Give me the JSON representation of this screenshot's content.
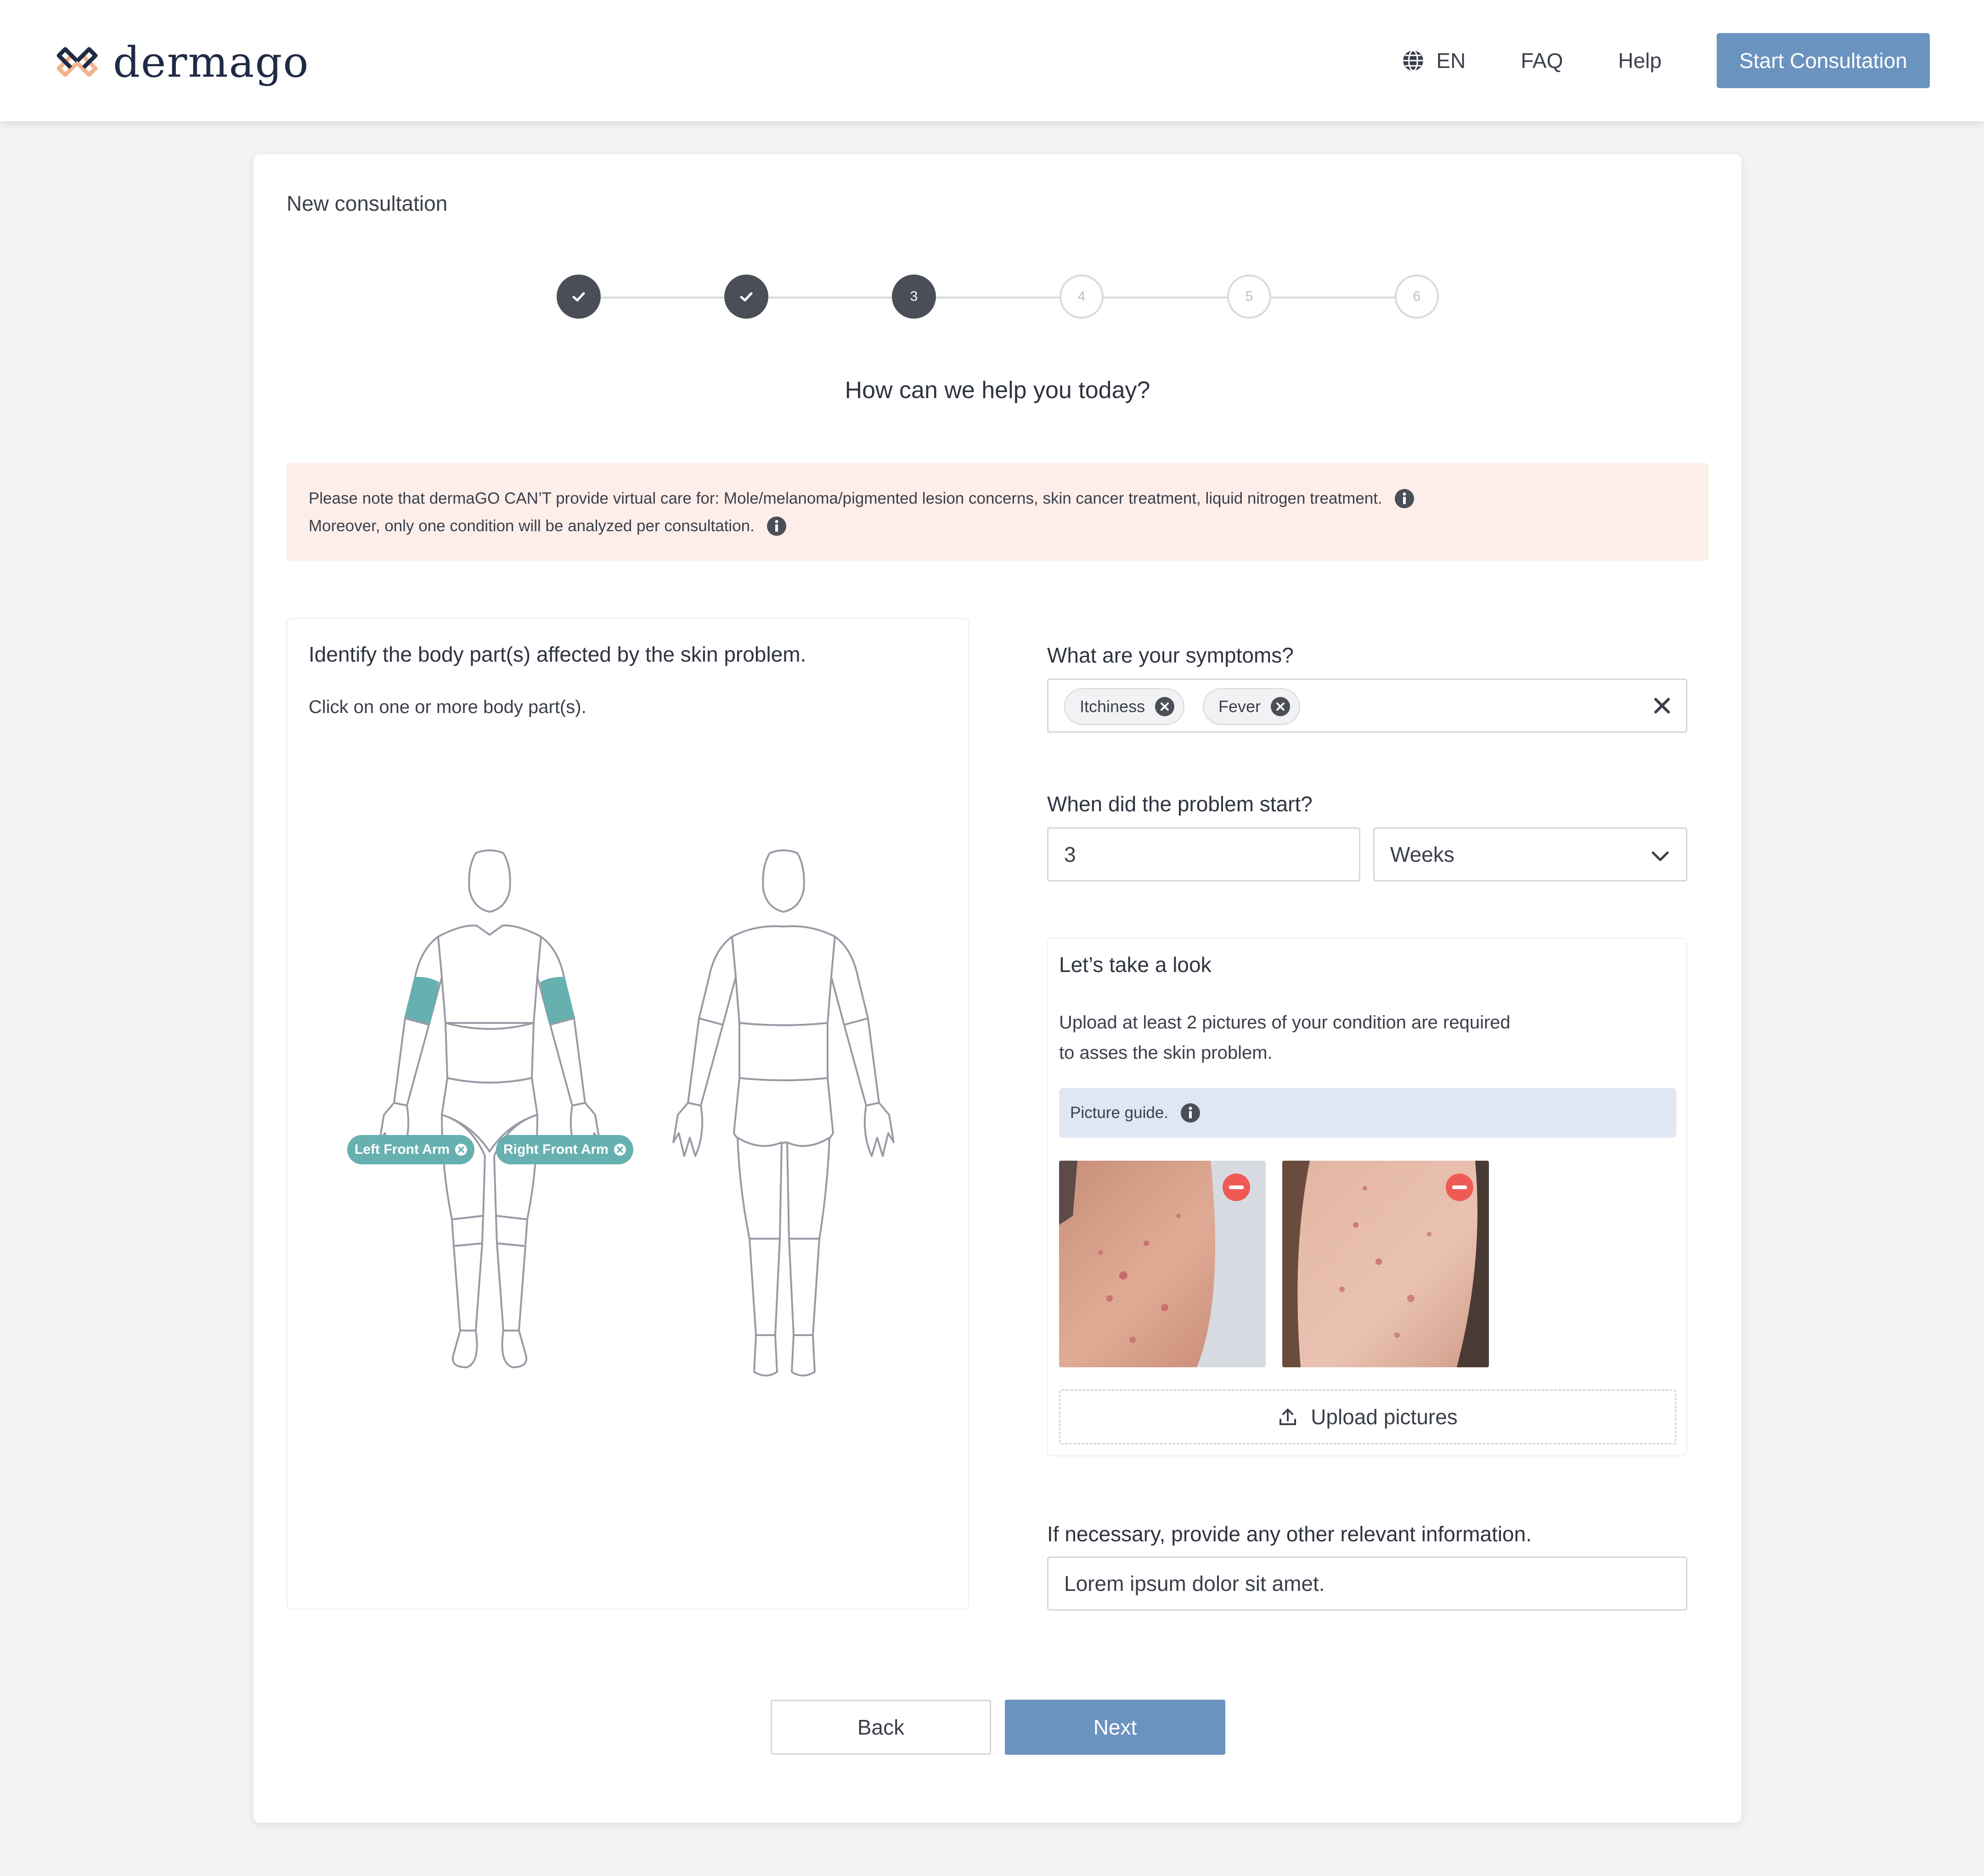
{
  "header": {
    "logo_text": "dermago",
    "language": "EN",
    "nav_faq": "FAQ",
    "nav_help": "Help",
    "start_button": "Start Consultation"
  },
  "consultation": {
    "title": "New consultation",
    "steps": [
      {
        "label": "",
        "state": "done"
      },
      {
        "label": "",
        "state": "done"
      },
      {
        "label": "3",
        "state": "current"
      },
      {
        "label": "4",
        "state": "todo"
      },
      {
        "label": "5",
        "state": "todo"
      },
      {
        "label": "6",
        "state": "todo"
      }
    ],
    "question": "How can we help you today?",
    "notice_line1": "Please note that dermaGO CAN’T provide virtual care for: Mole/melanoma/pigmented lesion concerns, skin cancer treatment, liquid nitrogen treatment.",
    "notice_line2": "Moreover, only one condition will be analyzed per consultation."
  },
  "body_map": {
    "title": "Identify the body part(s) affected by the skin problem.",
    "subtitle": "Click on one or more body part(s).",
    "selected": [
      "Left Front Arm",
      "Right Front Arm"
    ]
  },
  "symptoms": {
    "label": "What are your symptoms?",
    "tags": [
      "Itchiness",
      "Fever"
    ]
  },
  "onset": {
    "label": "When did the problem start?",
    "value": "3",
    "unit": "Weeks"
  },
  "photos": {
    "title": "Let’s take a look",
    "text": "Upload at least 2 pictures of your condition are required to asses the skin problem.",
    "guide": "Picture guide.",
    "upload_label": "Upload pictures"
  },
  "other_info": {
    "label": "If necessary, provide any other relevant information.",
    "value": "Lorem ipsum dolor sit amet."
  },
  "actions": {
    "back": "Back",
    "next": "Next"
  },
  "colors": {
    "accent": "#6b93c0",
    "highlight": "#67b0b0",
    "notice_bg": "#fdeeea",
    "guide_bg": "#dfe7f3",
    "remove": "#ef5a55"
  }
}
